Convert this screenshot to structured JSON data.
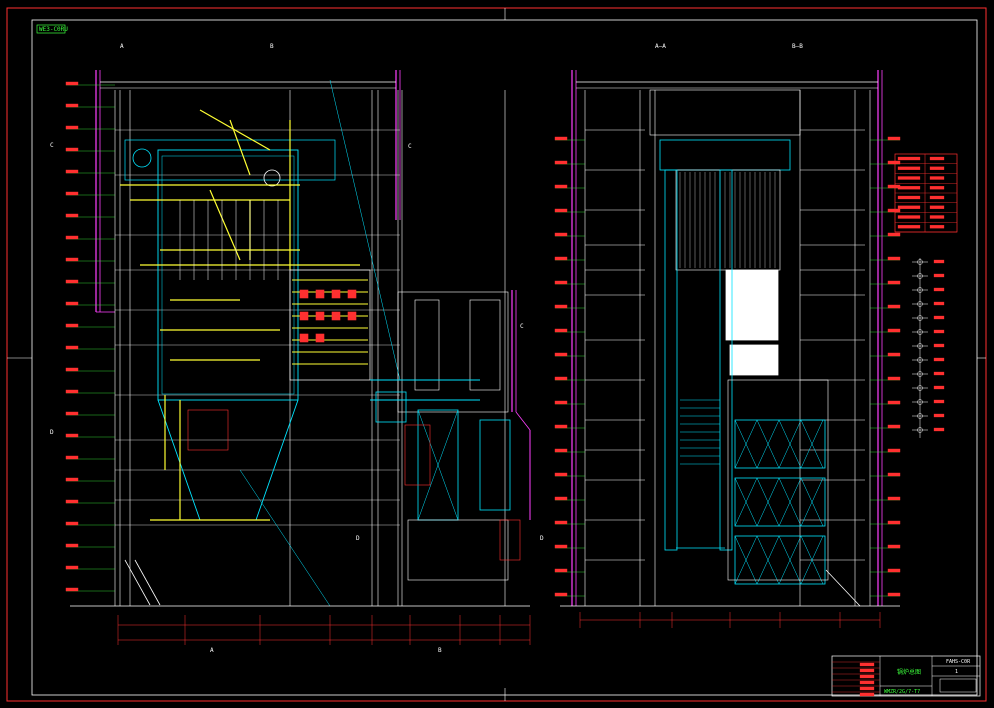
{
  "drawing": {
    "stamp": "WE3-C0RU",
    "section_tags": {
      "left_a": "A",
      "left_b": "B",
      "left_c": "C",
      "left_d": "D",
      "left_c2": "C",
      "left_c3": "C",
      "left_d2": "D",
      "left_d3": "D",
      "left_a_bottom": "A",
      "left_b_bottom": "B",
      "right_aa": "A—A",
      "right_bb": "B—B"
    },
    "title_block": {
      "title": "锅炉总图",
      "drawing_no": "FAHS-C0R",
      "sheet": "1",
      "bottom_code": "WMZR/2G/7-T7"
    },
    "colors": {
      "frame": "#ff3030",
      "structure": "#ffffff",
      "duct": "#00e5ff",
      "pipe": "#ffff33",
      "steel": "#ff40ff",
      "dimension": "#ff3030",
      "leader": "#3cff3c"
    }
  }
}
